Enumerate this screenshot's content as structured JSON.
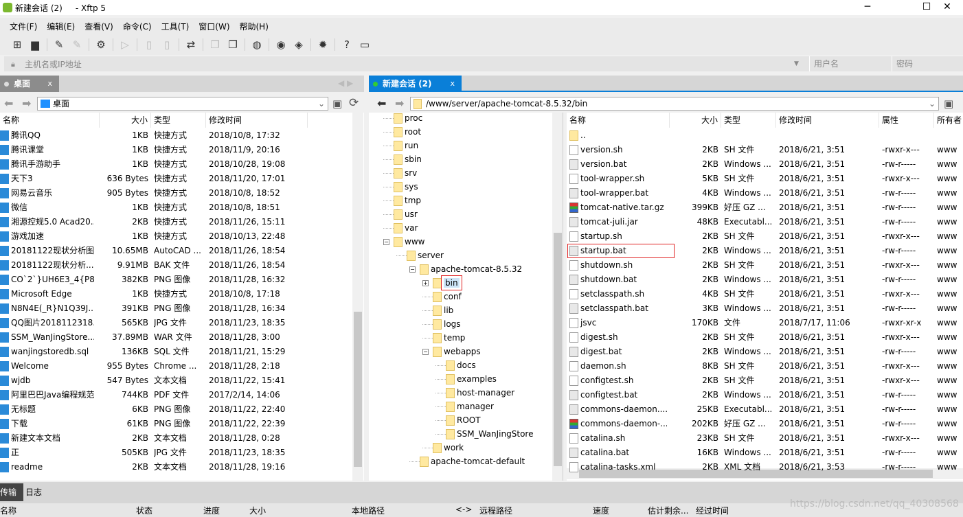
{
  "window": {
    "title": "新建会话 (2)     - Xftp 5",
    "minimize": "─",
    "maximize": "☐",
    "close": "✕"
  },
  "menu": [
    "文件(F)",
    "编辑(E)",
    "查看(V)",
    "命令(C)",
    "工具(T)",
    "窗口(W)",
    "帮助(H)"
  ],
  "toolbar": [
    {
      "icon": "new-session-icon",
      "g": "⊞"
    },
    {
      "icon": "open-folder-icon",
      "g": "▆"
    },
    {
      "icon": "connect-icon",
      "g": "✎"
    },
    {
      "icon": "disconnect-icon",
      "g": "✎",
      "dis": true
    },
    {
      "icon": "properties-icon",
      "g": "⚙"
    },
    {
      "icon": "play-icon",
      "g": "▷",
      "dis": true
    },
    {
      "icon": "copy-file-icon",
      "g": "▯",
      "dis": true
    },
    {
      "icon": "paste-file-icon",
      "g": "▯",
      "dis": true
    },
    {
      "icon": "transfer-icon",
      "g": "⇄"
    },
    {
      "icon": "copy-icon",
      "g": "❐",
      "dis": true
    },
    {
      "icon": "paste-icon",
      "g": "❐"
    },
    {
      "icon": "globe-icon",
      "g": "◍"
    },
    {
      "icon": "xshell-icon",
      "g": "◉"
    },
    {
      "icon": "xftp-icon",
      "g": "◈"
    },
    {
      "icon": "settings-icon",
      "g": "✹"
    },
    {
      "icon": "help-icon",
      "g": "?"
    },
    {
      "icon": "feedback-icon",
      "g": "▭"
    }
  ],
  "address": {
    "host_placeholder": "主机名或IP地址",
    "user_placeholder": "用户名",
    "password_placeholder": "密码"
  },
  "left": {
    "tab": "桌面",
    "tab_close": "x",
    "path": "桌面",
    "columns": [
      "名称",
      "大小",
      "类型",
      "修改时间"
    ],
    "rows": [
      [
        "腾讯QQ",
        "1KB",
        "快捷方式",
        "2018/10/8, 17:32"
      ],
      [
        "腾讯课堂",
        "1KB",
        "快捷方式",
        "2018/11/9, 20:16"
      ],
      [
        "腾讯手游助手",
        "1KB",
        "快捷方式",
        "2018/10/28, 19:08"
      ],
      [
        "天下3",
        "636 Bytes",
        "快捷方式",
        "2018/11/20, 17:01"
      ],
      [
        "网易云音乐",
        "905 Bytes",
        "快捷方式",
        "2018/10/8, 18:52"
      ],
      [
        "微信",
        "1KB",
        "快捷方式",
        "2018/10/8, 18:51"
      ],
      [
        "湘源控规5.0 Acad20...",
        "2KB",
        "快捷方式",
        "2018/11/26, 15:11"
      ],
      [
        "游戏加速",
        "1KB",
        "快捷方式",
        "2018/10/13, 22:48"
      ],
      [
        "20181122现状分析图",
        "10.65MB",
        "AutoCAD ...",
        "2018/11/26, 18:54"
      ],
      [
        "20181122现状分析...",
        "9.91MB",
        "BAK 文件",
        "2018/11/26, 18:54"
      ],
      [
        "CO`2`}UH6E3_4{P8{...",
        "382KB",
        "PNG 图像",
        "2018/11/28, 16:32"
      ],
      [
        "Microsoft Edge",
        "1KB",
        "快捷方式",
        "2018/10/8, 17:18"
      ],
      [
        "N8N4E(_R}N1Q39J...",
        "391KB",
        "PNG 图像",
        "2018/11/28, 16:34"
      ],
      [
        "QQ图片2018112318...",
        "565KB",
        "JPG 文件",
        "2018/11/23, 18:35"
      ],
      [
        "SSM_WanJingStore....",
        "37.89MB",
        "WAR 文件",
        "2018/11/28, 3:00"
      ],
      [
        "wanjingstoredb.sql",
        "136KB",
        "SQL 文件",
        "2018/11/21, 15:29"
      ],
      [
        "Welcome",
        "955 Bytes",
        "Chrome ...",
        "2018/11/28, 2:18"
      ],
      [
        "wjdb",
        "547 Bytes",
        "文本文档",
        "2018/11/22, 15:41"
      ],
      [
        "阿里巴巴Java编程规范",
        "744KB",
        "PDF 文件",
        "2017/2/14, 14:06"
      ],
      [
        "无标题",
        "6KB",
        "PNG 图像",
        "2018/11/22, 22:40"
      ],
      [
        "下载",
        "61KB",
        "PNG 图像",
        "2018/11/22, 22:39"
      ],
      [
        "新建文本文档",
        "2KB",
        "文本文档",
        "2018/11/28, 0:28"
      ],
      [
        "正",
        "505KB",
        "JPG 文件",
        "2018/11/23, 18:35"
      ],
      [
        "readme",
        "2KB",
        "文本文档",
        "2018/11/28, 19:16"
      ]
    ]
  },
  "right": {
    "tab": "新建会话 (2)",
    "tab_close": "x",
    "path": "/www/server/apache-tomcat-8.5.32/bin",
    "tree": [
      [
        "proc",
        0
      ],
      [
        "root",
        0
      ],
      [
        "run",
        0
      ],
      [
        "sbin",
        0
      ],
      [
        "srv",
        0
      ],
      [
        "sys",
        0
      ],
      [
        "tmp",
        0
      ],
      [
        "usr",
        0
      ],
      [
        "var",
        0
      ],
      [
        "www",
        0,
        "−"
      ],
      [
        "server",
        1,
        ""
      ],
      [
        "apache-tomcat-8.5.32",
        2,
        "−"
      ],
      [
        "bin",
        3,
        "+"
      ],
      [
        "conf",
        3
      ],
      [
        "lib",
        3
      ],
      [
        "logs",
        3
      ],
      [
        "temp",
        3
      ],
      [
        "webapps",
        3,
        "−"
      ],
      [
        "docs",
        4
      ],
      [
        "examples",
        4
      ],
      [
        "host-manager",
        4
      ],
      [
        "manager",
        4
      ],
      [
        "ROOT",
        4
      ],
      [
        "SSM_WanJingStore",
        4
      ],
      [
        "work",
        3
      ],
      [
        "apache-tomcat-default",
        2
      ]
    ],
    "selected_tree": "bin",
    "columns": [
      "名称",
      "大小",
      "类型",
      "修改时间",
      "属性",
      "所有者"
    ],
    "rows": [
      [
        "..",
        "",
        "",
        "",
        "",
        "",
        "folder"
      ],
      [
        "version.sh",
        "2KB",
        "SH 文件",
        "2018/6/21, 3:51",
        "-rwxr-x---",
        "www",
        ""
      ],
      [
        "version.bat",
        "2KB",
        "Windows ...",
        "2018/6/21, 3:51",
        "-rw-r-----",
        "www",
        "bat"
      ],
      [
        "tool-wrapper.sh",
        "5KB",
        "SH 文件",
        "2018/6/21, 3:51",
        "-rwxr-x---",
        "www",
        ""
      ],
      [
        "tool-wrapper.bat",
        "4KB",
        "Windows ...",
        "2018/6/21, 3:51",
        "-rw-r-----",
        "www",
        "bat"
      ],
      [
        "tomcat-native.tar.gz",
        "399KB",
        "好压 GZ ...",
        "2018/6/21, 3:51",
        "-rw-r-----",
        "www",
        "gz"
      ],
      [
        "tomcat-juli.jar",
        "48KB",
        "Executabl...",
        "2018/6/21, 3:51",
        "-rw-r-----",
        "www",
        "bat"
      ],
      [
        "startup.sh",
        "2KB",
        "SH 文件",
        "2018/6/21, 3:51",
        "-rwxr-x---",
        "www",
        ""
      ],
      [
        "startup.bat",
        "2KB",
        "Windows ...",
        "2018/6/21, 3:51",
        "-rw-r-----",
        "www",
        "bat"
      ],
      [
        "shutdown.sh",
        "2KB",
        "SH 文件",
        "2018/6/21, 3:51",
        "-rwxr-x---",
        "www",
        ""
      ],
      [
        "shutdown.bat",
        "2KB",
        "Windows ...",
        "2018/6/21, 3:51",
        "-rw-r-----",
        "www",
        "bat"
      ],
      [
        "setclasspath.sh",
        "4KB",
        "SH 文件",
        "2018/6/21, 3:51",
        "-rwxr-x---",
        "www",
        ""
      ],
      [
        "setclasspath.bat",
        "3KB",
        "Windows ...",
        "2018/6/21, 3:51",
        "-rw-r-----",
        "www",
        "bat"
      ],
      [
        "jsvc",
        "170KB",
        "文件",
        "2018/7/17, 11:06",
        "-rwxr-xr-x",
        "www",
        ""
      ],
      [
        "digest.sh",
        "2KB",
        "SH 文件",
        "2018/6/21, 3:51",
        "-rwxr-x---",
        "www",
        ""
      ],
      [
        "digest.bat",
        "2KB",
        "Windows ...",
        "2018/6/21, 3:51",
        "-rw-r-----",
        "www",
        "bat"
      ],
      [
        "daemon.sh",
        "8KB",
        "SH 文件",
        "2018/6/21, 3:51",
        "-rwxr-x---",
        "www",
        ""
      ],
      [
        "configtest.sh",
        "2KB",
        "SH 文件",
        "2018/6/21, 3:51",
        "-rwxr-x---",
        "www",
        ""
      ],
      [
        "configtest.bat",
        "2KB",
        "Windows ...",
        "2018/6/21, 3:51",
        "-rw-r-----",
        "www",
        "bat"
      ],
      [
        "commons-daemon....",
        "25KB",
        "Executabl...",
        "2018/6/21, 3:51",
        "-rw-r-----",
        "www",
        "bat"
      ],
      [
        "commons-daemon-...",
        "202KB",
        "好压 GZ ...",
        "2018/6/21, 3:51",
        "-rw-r-----",
        "www",
        "gz"
      ],
      [
        "catalina.sh",
        "23KB",
        "SH 文件",
        "2018/6/21, 3:51",
        "-rwxr-x---",
        "www",
        ""
      ],
      [
        "catalina.bat",
        "16KB",
        "Windows ...",
        "2018/6/21, 3:51",
        "-rw-r-----",
        "www",
        "bat"
      ],
      [
        "catalina-tasks.xml",
        "2KB",
        "XML 文档",
        "2018/6/21, 3:53",
        "-rw-r-----",
        "www",
        ""
      ]
    ],
    "highlighted_row": "startup.bat"
  },
  "bottom": {
    "tabs": [
      "传输",
      "日志"
    ],
    "columns": [
      "名称",
      "状态",
      "进度",
      "大小",
      "本地路径",
      "<->",
      "远程路径",
      "速度",
      "估计剩余...",
      "经过时间"
    ]
  },
  "watermark": "https://blog.csdn.net/qq_40308568",
  "colors": {
    "accent": "#0a7fd8",
    "left_tab": "#8c8c8c",
    "highlight_box": "#e02020"
  }
}
